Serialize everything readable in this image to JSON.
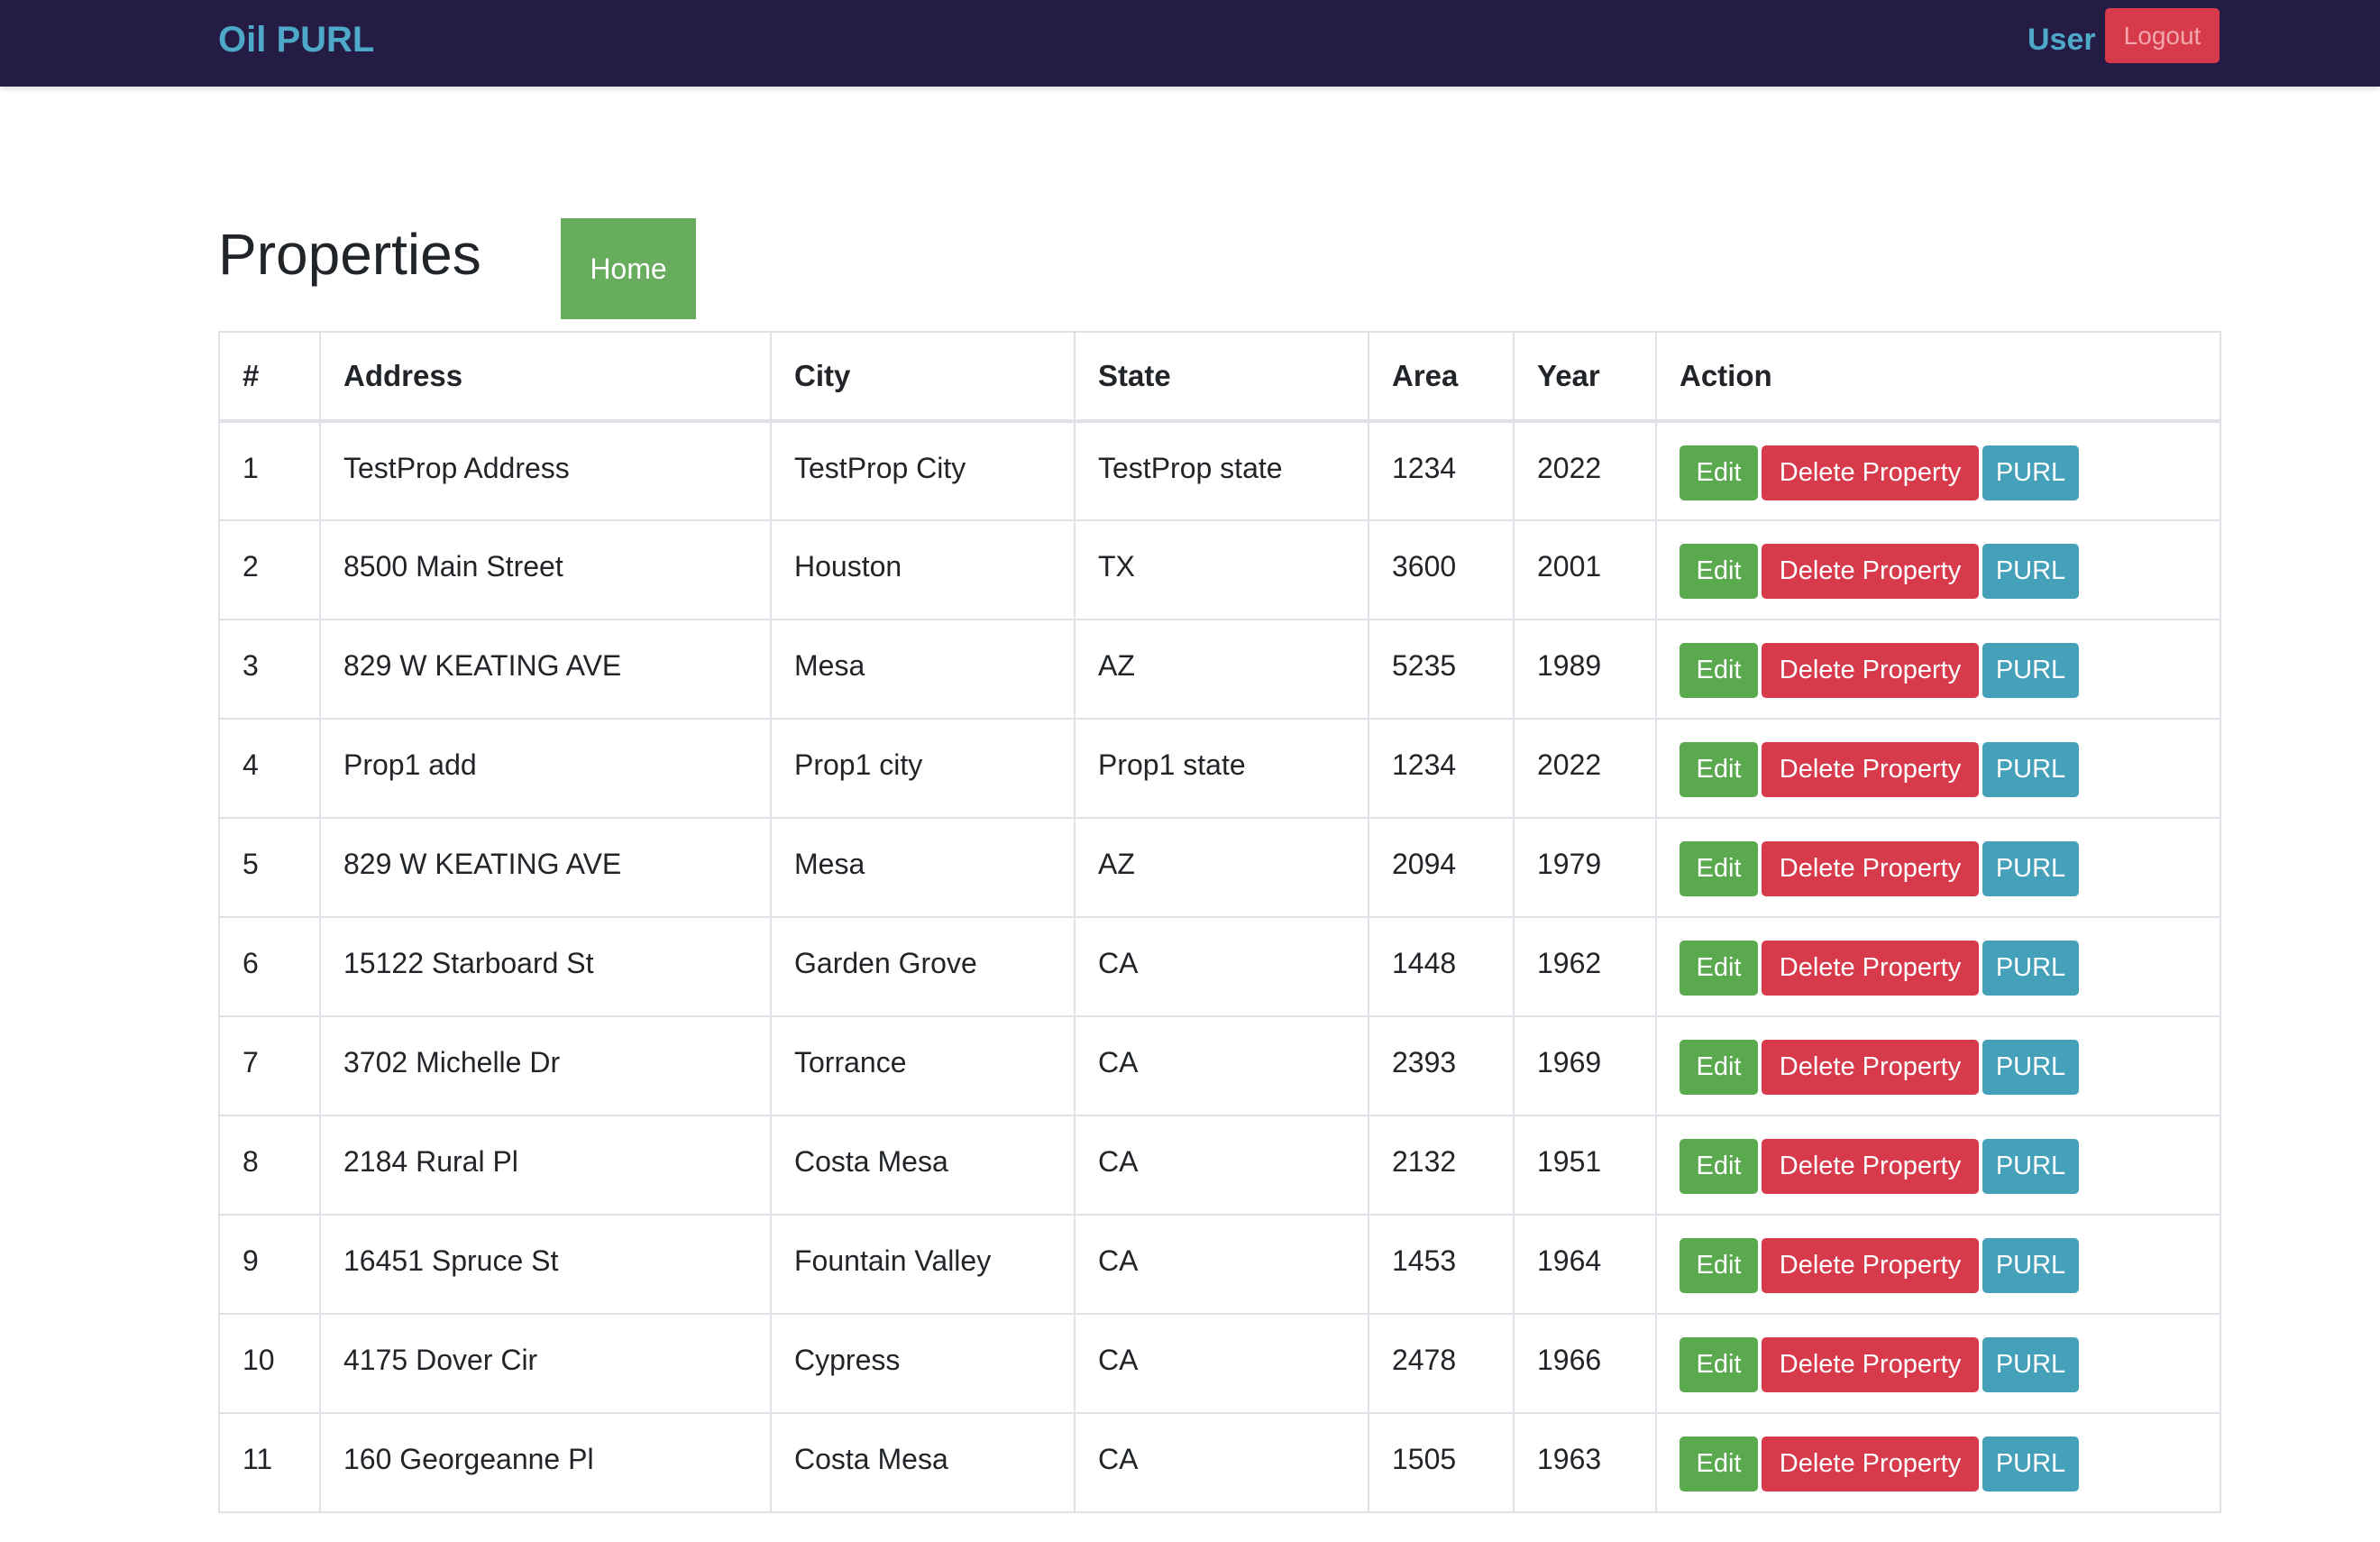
{
  "navbar": {
    "brand": "Oil PURL",
    "user": "User",
    "logout_label": "Logout"
  },
  "page": {
    "title": "Properties",
    "home_label": "Home"
  },
  "colors": {
    "navbar_bg": "#251c46",
    "brand": "#4ea9c8",
    "success": "#5aa94f",
    "danger": "#d63a4b",
    "info": "#45a0ba"
  },
  "table": {
    "columns": [
      "#",
      "Address",
      "City",
      "State",
      "Area",
      "Year",
      "Action"
    ],
    "action_labels": {
      "edit": "Edit",
      "delete": "Delete Property",
      "purl": "PURL"
    },
    "rows": [
      {
        "num": "1",
        "address": "TestProp Address",
        "city": "TestProp City",
        "state": "TestProp state",
        "area": "1234",
        "year": "2022"
      },
      {
        "num": "2",
        "address": "8500 Main Street",
        "city": "Houston",
        "state": "TX",
        "area": "3600",
        "year": "2001"
      },
      {
        "num": "3",
        "address": "829 W KEATING AVE",
        "city": "Mesa",
        "state": "AZ",
        "area": "5235",
        "year": "1989"
      },
      {
        "num": "4",
        "address": "Prop1 add",
        "city": "Prop1 city",
        "state": "Prop1 state",
        "area": "1234",
        "year": "2022"
      },
      {
        "num": "5",
        "address": "829 W KEATING AVE",
        "city": "Mesa",
        "state": "AZ",
        "area": "2094",
        "year": "1979"
      },
      {
        "num": "6",
        "address": "15122 Starboard St",
        "city": "Garden Grove",
        "state": "CA",
        "area": "1448",
        "year": "1962"
      },
      {
        "num": "7",
        "address": "3702 Michelle Dr",
        "city": "Torrance",
        "state": "CA",
        "area": "2393",
        "year": "1969"
      },
      {
        "num": "8",
        "address": "2184 Rural Pl",
        "city": "Costa Mesa",
        "state": "CA",
        "area": "2132",
        "year": "1951"
      },
      {
        "num": "9",
        "address": "16451 Spruce St",
        "city": "Fountain Valley",
        "state": "CA",
        "area": "1453",
        "year": "1964"
      },
      {
        "num": "10",
        "address": "4175 Dover Cir",
        "city": "Cypress",
        "state": "CA",
        "area": "2478",
        "year": "1966"
      },
      {
        "num": "11",
        "address": "160 Georgeanne Pl",
        "city": "Costa Mesa",
        "state": "CA",
        "area": "1505",
        "year": "1963"
      }
    ]
  }
}
